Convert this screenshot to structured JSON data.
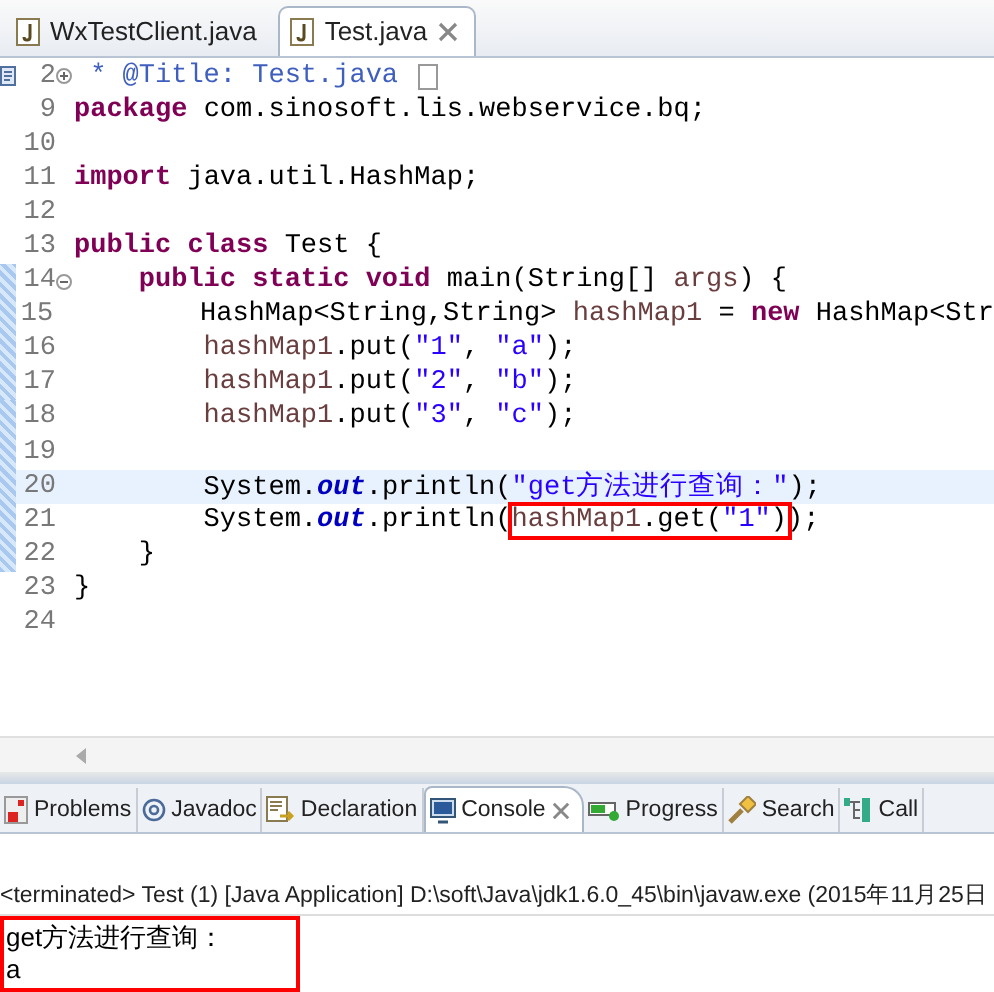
{
  "editor_tabs": [
    {
      "label": "WxTestClient.java",
      "selected": false
    },
    {
      "label": "Test.java",
      "selected": true
    }
  ],
  "editor": {
    "lines": [
      {
        "number": "2",
        "current": false,
        "ruler": false,
        "collapsed": true,
        "groups": [
          {
            "boxed": false,
            "tokens": [
              {
                "kind": "comment",
                "text": " * @Title: Test.java "
              }
            ]
          }
        ]
      },
      {
        "number": "9",
        "current": false,
        "ruler": false,
        "groups": [
          {
            "boxed": false,
            "tokens": [
              {
                "kind": "keyword",
                "text": "package "
              },
              {
                "kind": "plain",
                "text": "com.sinosoft.lis.webservice.bq;"
              }
            ]
          }
        ]
      },
      {
        "number": "10",
        "current": false,
        "ruler": false
      },
      {
        "number": "11",
        "current": false,
        "ruler": false,
        "groups": [
          {
            "boxed": false,
            "tokens": [
              {
                "kind": "keyword",
                "text": "import "
              },
              {
                "kind": "plain",
                "text": "java.util.HashMap;"
              }
            ]
          }
        ]
      },
      {
        "number": "12",
        "current": false,
        "ruler": false
      },
      {
        "number": "13",
        "current": false,
        "ruler": false,
        "groups": [
          {
            "boxed": false,
            "tokens": [
              {
                "kind": "keyword",
                "text": "public class "
              },
              {
                "kind": "plain",
                "text": "Test {"
              }
            ]
          }
        ]
      },
      {
        "number": "14",
        "current": false,
        "ruler": true,
        "collapsed": false,
        "groups": [
          {
            "boxed": false,
            "tokens": [
              {
                "kind": "keyword",
                "text": "    public static void "
              },
              {
                "kind": "plain",
                "text": "main(String[] "
              },
              {
                "kind": "variable",
                "text": "args"
              },
              {
                "kind": "plain",
                "text": ") {"
              }
            ]
          }
        ]
      },
      {
        "number": "15",
        "current": false,
        "ruler": true,
        "groups": [
          {
            "boxed": false,
            "tokens": [
              {
                "kind": "plain",
                "text": "        HashMap<String,String> "
              },
              {
                "kind": "variable",
                "text": "hashMap1"
              },
              {
                "kind": "plain",
                "text": " = "
              },
              {
                "kind": "keyword",
                "text": "new "
              },
              {
                "kind": "plain",
                "text": "HashMap<Str"
              }
            ]
          }
        ]
      },
      {
        "number": "16",
        "current": false,
        "ruler": true,
        "groups": [
          {
            "boxed": false,
            "tokens": [
              {
                "kind": "variable",
                "text": "        hashMap1"
              },
              {
                "kind": "plain",
                "text": ".put("
              },
              {
                "kind": "string",
                "text": "\"1\""
              },
              {
                "kind": "plain",
                "text": ", "
              },
              {
                "kind": "string",
                "text": "\"a\""
              },
              {
                "kind": "plain",
                "text": ");"
              }
            ]
          }
        ]
      },
      {
        "number": "17",
        "current": false,
        "ruler": true,
        "groups": [
          {
            "boxed": false,
            "tokens": [
              {
                "kind": "variable",
                "text": "        hashMap1"
              },
              {
                "kind": "plain",
                "text": ".put("
              },
              {
                "kind": "string",
                "text": "\"2\""
              },
              {
                "kind": "plain",
                "text": ", "
              },
              {
                "kind": "string",
                "text": "\"b\""
              },
              {
                "kind": "plain",
                "text": ");"
              }
            ]
          }
        ]
      },
      {
        "number": "18",
        "current": false,
        "ruler": true,
        "groups": [
          {
            "boxed": false,
            "tokens": [
              {
                "kind": "variable",
                "text": "        hashMap1"
              },
              {
                "kind": "plain",
                "text": ".put("
              },
              {
                "kind": "string",
                "text": "\"3\""
              },
              {
                "kind": "plain",
                "text": ", "
              },
              {
                "kind": "string",
                "text": "\"c\""
              },
              {
                "kind": "plain",
                "text": ");"
              }
            ]
          }
        ]
      },
      {
        "number": "19",
        "current": false,
        "ruler": true
      },
      {
        "number": "20",
        "current": true,
        "ruler": true,
        "groups": [
          {
            "boxed": false,
            "tokens": [
              {
                "kind": "plain",
                "text": "        System."
              },
              {
                "kind": "field",
                "text": "out"
              },
              {
                "kind": "plain",
                "text": ".println("
              },
              {
                "kind": "string",
                "text": "\"get方法进行查询：\""
              },
              {
                "kind": "plain",
                "text": ");"
              }
            ]
          }
        ]
      },
      {
        "number": "21",
        "current": false,
        "ruler": true,
        "groups": [
          {
            "boxed": false,
            "tokens": [
              {
                "kind": "plain",
                "text": "        System."
              },
              {
                "kind": "field",
                "text": "out"
              },
              {
                "kind": "plain",
                "text": ".println("
              }
            ]
          },
          {
            "boxed": true,
            "tokens": [
              {
                "kind": "variable",
                "text": "hashMap1"
              },
              {
                "kind": "plain",
                "text": ".get("
              },
              {
                "kind": "string",
                "text": "\"1\""
              },
              {
                "kind": "plain",
                "text": ")"
              }
            ]
          },
          {
            "boxed": false,
            "tokens": [
              {
                "kind": "plain",
                "text": ");"
              }
            ]
          }
        ]
      },
      {
        "number": "22",
        "current": false,
        "ruler": true,
        "groups": [
          {
            "boxed": false,
            "tokens": [
              {
                "kind": "plain",
                "text": "    }"
              }
            ]
          }
        ]
      },
      {
        "number": "23",
        "current": false,
        "ruler": false,
        "groups": [
          {
            "boxed": false,
            "tokens": [
              {
                "kind": "plain",
                "text": "}"
              }
            ]
          }
        ]
      },
      {
        "number": "24",
        "current": false,
        "ruler": false
      }
    ]
  },
  "view_tabs": [
    {
      "label": "Problems",
      "selected": false
    },
    {
      "label": "Javadoc",
      "selected": false
    },
    {
      "label": "Declaration",
      "selected": false
    },
    {
      "label": "Console",
      "selected": true
    },
    {
      "label": "Progress",
      "selected": false
    },
    {
      "label": "Search",
      "selected": false
    },
    {
      "label": "Call",
      "selected": false
    }
  ],
  "console": {
    "header": "<terminated> Test (1) [Java Application] D:\\soft\\Java\\jdk1.6.0_45\\bin\\javaw.exe (2015年11月25日",
    "output_boxed": true,
    "output": [
      "get方法进行查询：",
      "a"
    ]
  }
}
